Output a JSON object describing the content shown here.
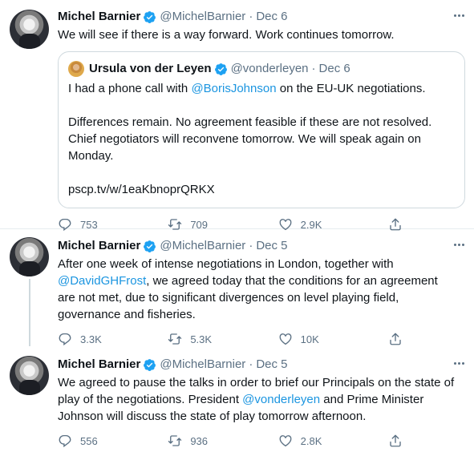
{
  "tweets": [
    {
      "author": "Michel Barnier",
      "handle": "@MichelBarnier",
      "date": "Dec 6",
      "text": "We will see if there is a way forward. Work continues tomorrow.",
      "quote": {
        "author": "Ursula von der Leyen",
        "handle": "@vonderleyen",
        "date": "Dec 6",
        "para1_prefix": "I had a phone call with ",
        "para1_mention": "@BorisJohnson",
        "para1_suffix": " on the EU-UK negotiations.",
        "para2": "Differences remain. No agreement feasible if these are not resolved. Chief negotiators will reconvene tomorrow. We will speak again on Monday.",
        "link": "pscp.tv/w/1eaKbnoprQRKX"
      },
      "replies": "753",
      "retweets": "709",
      "likes": "2.9K"
    },
    {
      "author": "Michel Barnier",
      "handle": "@MichelBarnier",
      "date": "Dec 5",
      "text_prefix": "After one week of intense negotiations in London, together with ",
      "mention": "@DavidGHFrost",
      "text_suffix": ", we agreed today that the conditions for an agreement are not met, due to significant divergences on level playing field, governance and fisheries.",
      "replies": "3.3K",
      "retweets": "5.3K",
      "likes": "10K"
    },
    {
      "author": "Michel Barnier",
      "handle": "@MichelBarnier",
      "date": "Dec 5",
      "text_prefix": "We agreed to pause the talks in order to brief our Principals on the state of play of the negotiations. President ",
      "mention": "@vonderleyen",
      "text_suffix": " and Prime Minister Johnson will discuss the state of play tomorrow afternoon.",
      "replies": "556",
      "retweets": "936",
      "likes": "2.8K"
    }
  ],
  "separator": "·",
  "icons": [
    "verified-badge-icon",
    "more-icon",
    "reply-icon",
    "retweet-icon",
    "like-icon",
    "share-icon"
  ],
  "colors": {
    "accent": "#1b95e0",
    "muted": "#5b7083",
    "text": "#0f1419",
    "border": "#cfd9de"
  }
}
